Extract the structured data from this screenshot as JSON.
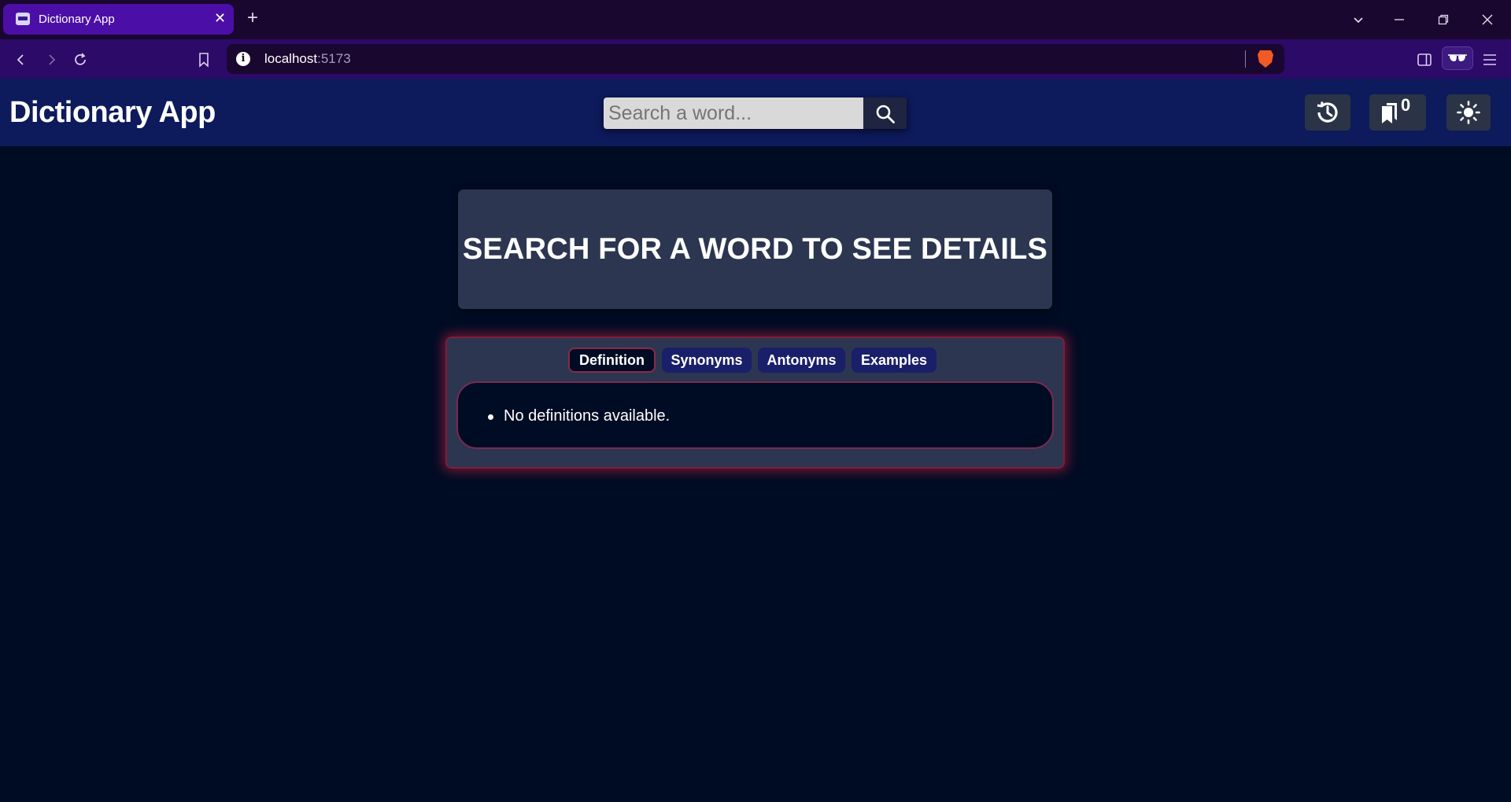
{
  "browser": {
    "tab_title": "Dictionary App",
    "tab_close": "✕",
    "new_tab": "+",
    "url_host": "localhost",
    "url_port": ":5173"
  },
  "header": {
    "title": "Dictionary App",
    "search_placeholder": "Search a word...",
    "bookmark_count": "0"
  },
  "main": {
    "hero_text": "SEARCH FOR A WORD TO SEE DETAILS",
    "tabs": [
      {
        "label": "Definition",
        "active": true
      },
      {
        "label": "Synonyms",
        "active": false
      },
      {
        "label": "Antonyms",
        "active": false
      },
      {
        "label": "Examples",
        "active": false
      }
    ],
    "content": {
      "items": [
        "No definitions available."
      ]
    }
  },
  "colors": {
    "background": "#000c24",
    "header": "#0d1a5c",
    "card": "#2c3650",
    "tab": "#1a1f6a",
    "glow": "#c81e3c"
  }
}
